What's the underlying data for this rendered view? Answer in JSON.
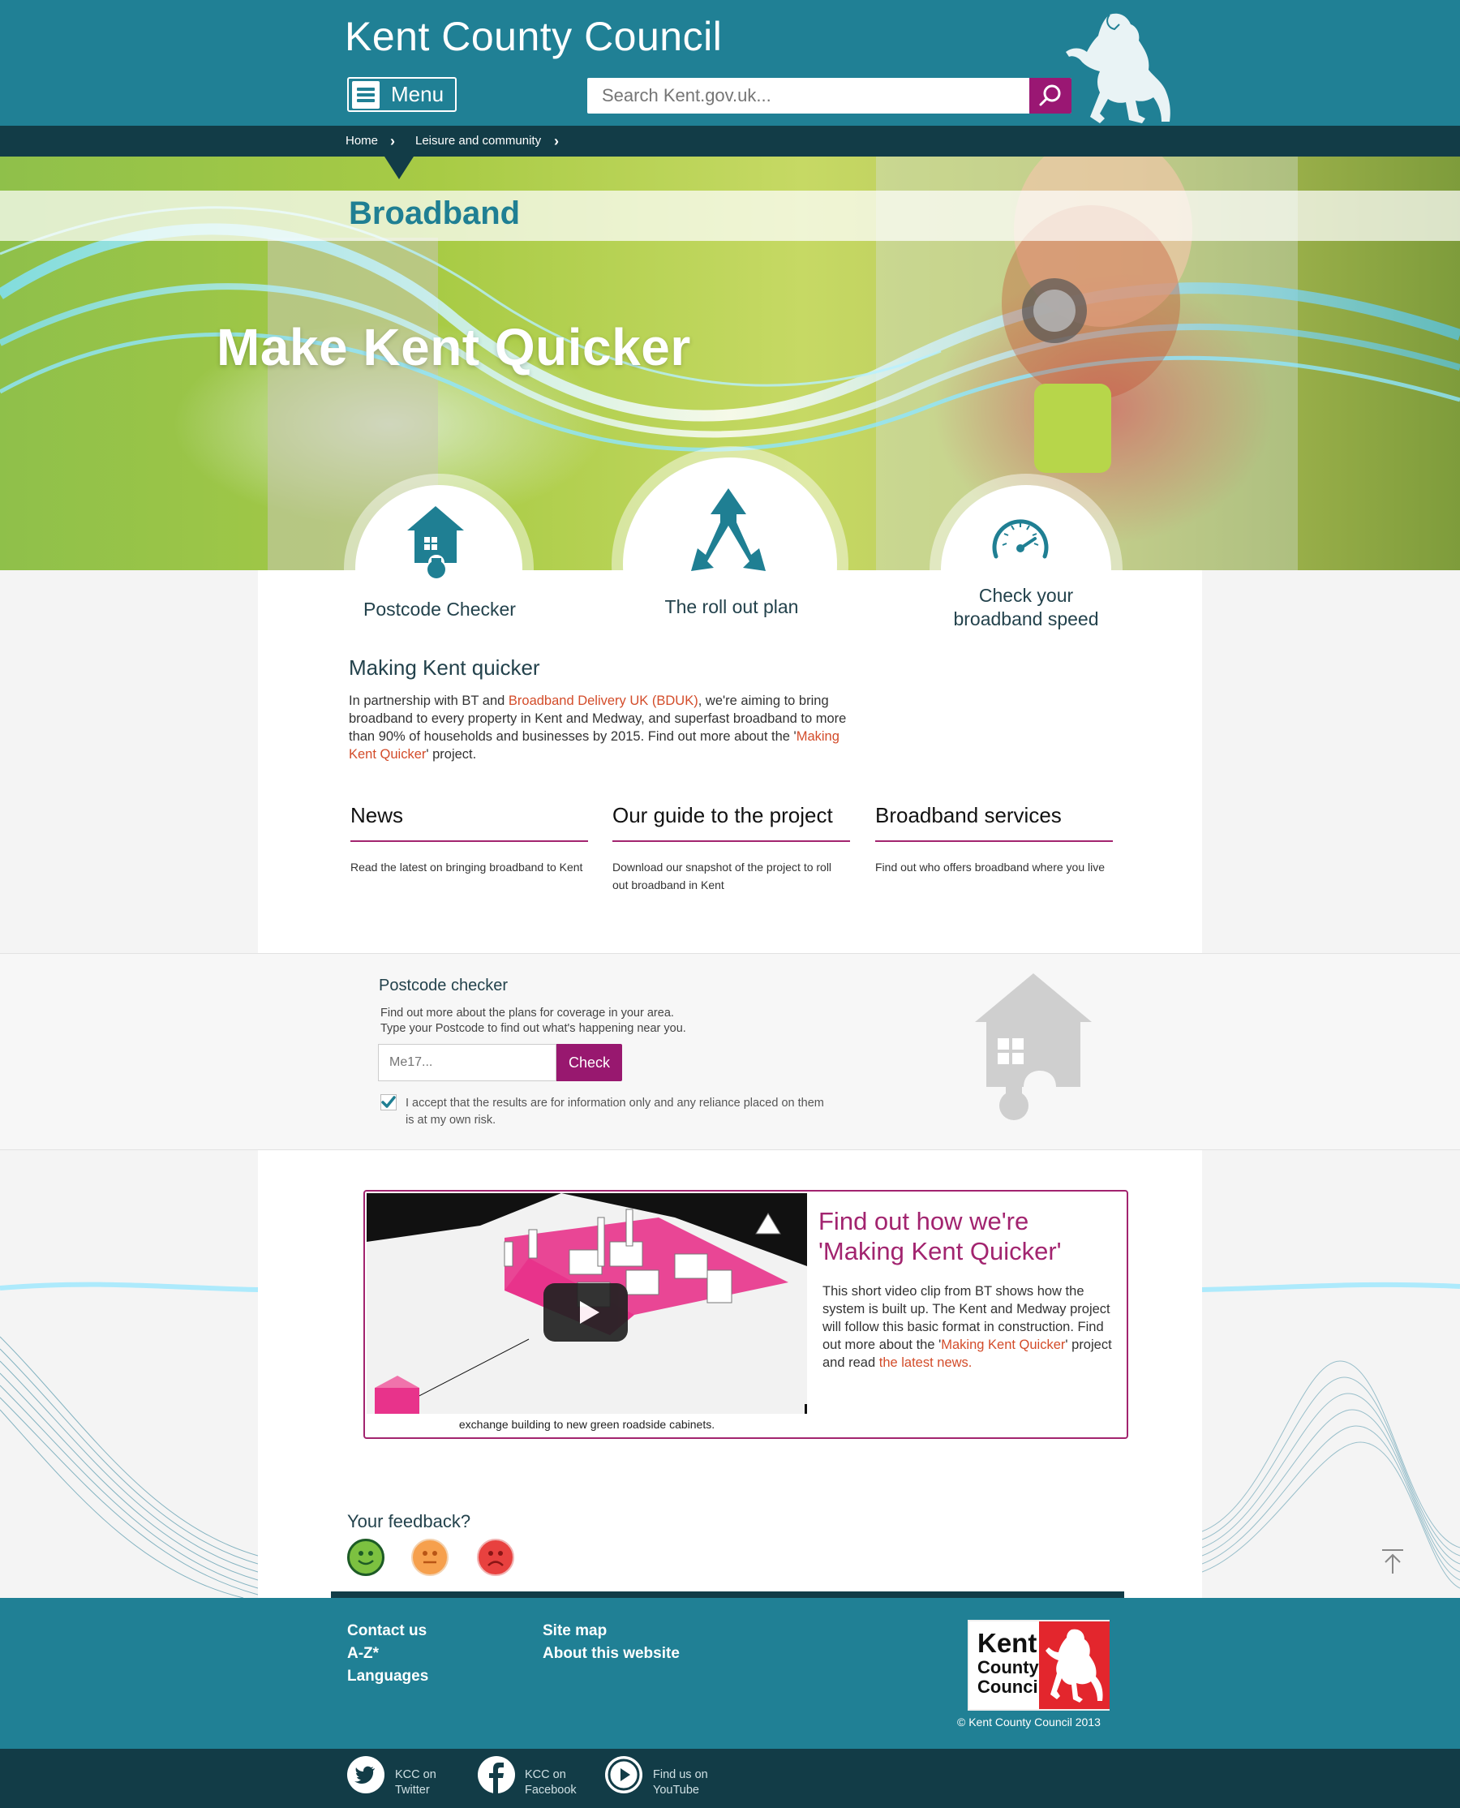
{
  "header": {
    "site_title": "Kent County Council",
    "menu_label": "Menu",
    "search_placeholder": "Search Kent.gov.uk..."
  },
  "breadcrumb": {
    "items": [
      "Home",
      "Leisure and community"
    ]
  },
  "hero": {
    "section_title": "Broadband",
    "heading": "Make Kent Quicker"
  },
  "quick_links": [
    {
      "label": "Postcode Checker",
      "icon": "house-puzzle-icon"
    },
    {
      "label": "The roll out plan",
      "icon": "arrows-split-icon"
    },
    {
      "label_line1": "Check your",
      "label_line2": "broadband speed",
      "icon": "speedometer-icon"
    }
  ],
  "intro": {
    "title": "Making Kent quicker",
    "text_1": "In partnership with BT and ",
    "link_1": "Broadband Delivery UK (BDUK)",
    "text_2": ", we're aiming to bring broadband to every property in Kent and Medway, and superfast broadband to more than 90% of households and businesses by 2015. Find out more about the '",
    "link_2": "Making Kent Quicker",
    "text_3": "' project."
  },
  "columns": [
    {
      "title": "News",
      "text": "Read the latest on bringing broadband to Kent"
    },
    {
      "title": "Our guide to the project",
      "text_line1": "Download our snapshot of the project to roll",
      "text_line2": "out broadband in Kent"
    },
    {
      "title": "Broadband services",
      "text": "Find out who offers broadband where you live"
    }
  ],
  "postcode": {
    "title": "Postcode checker",
    "text_line1": "Find out more about the plans for coverage in your area.",
    "text_line2": "Type your Postcode to find out what's happening near you.",
    "placeholder": "Me17...",
    "button": "Check",
    "consent_checked": true,
    "consent_line1": "I accept that the results are for information only and any reliance placed on them",
    "consent_line2": "is at my own risk."
  },
  "video": {
    "caption": "exchange building to new green roadside cabinets.",
    "title": "Find out how we're 'Making Kent Quicker'",
    "text_1": "This short video clip from BT shows how the system is built up.  The Kent and Medway project will follow this basic format in construction. Find out more about the '",
    "link_1": "Making Kent Quicker",
    "text_2": "' project and read ",
    "link_2": "the latest news."
  },
  "feedback": {
    "title": "Your feedback?",
    "options": [
      "happy",
      "neutral",
      "sad"
    ],
    "colors": {
      "happy": "#7cc140",
      "neutral": "#f6a04d",
      "sad": "#e8413f"
    }
  },
  "footer": {
    "links_col1": [
      "Contact us",
      "A-Z*",
      "Languages"
    ],
    "links_col2": [
      "Site map",
      "About this website"
    ],
    "logo_words": [
      "Kent",
      "County",
      "Council"
    ],
    "copyright": "© Kent County Council 2013",
    "social": [
      {
        "line1": "KCC on",
        "line2": "Twitter",
        "icon": "twitter-icon"
      },
      {
        "line1": "KCC on",
        "line2": "Facebook",
        "icon": "facebook-icon"
      },
      {
        "line1": "Find us on",
        "line2": "YouTube",
        "icon": "youtube-icon"
      }
    ]
  },
  "colors": {
    "brand_teal": "#208095",
    "dark_teal": "#123c47",
    "accent_magenta": "#a2246f",
    "link_orange": "#d34c2a"
  }
}
